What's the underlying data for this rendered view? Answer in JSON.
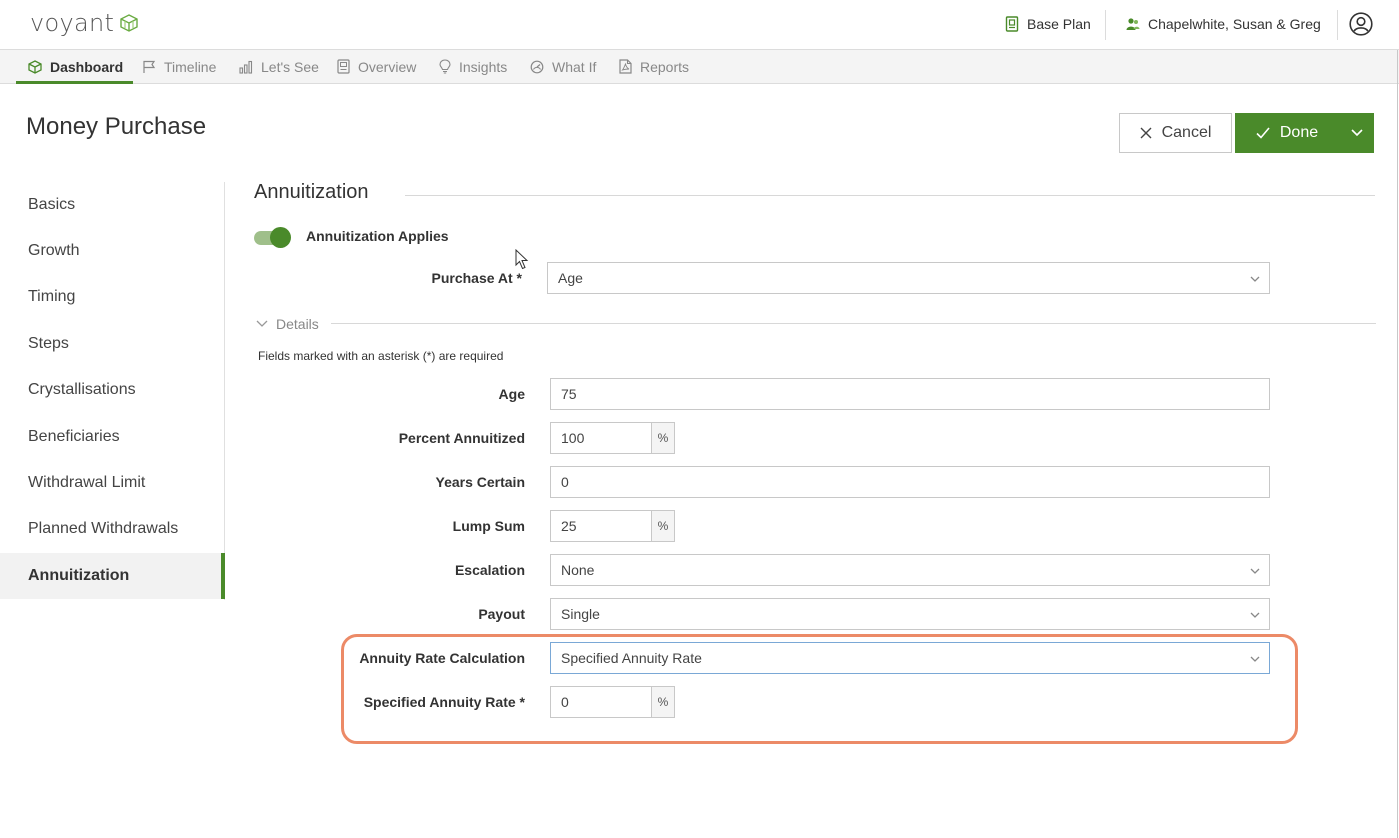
{
  "header": {
    "logo_text": "voyant",
    "plan_label": "Base Plan",
    "client_label": "Chapelwhite, Susan & Greg",
    "brand_color": "#4a8a2a"
  },
  "tabs": [
    {
      "label": "Dashboard",
      "icon": "dashboard-icon",
      "active": true
    },
    {
      "label": "Timeline",
      "icon": "flag-icon"
    },
    {
      "label": "Let's See",
      "icon": "bar-chart-icon"
    },
    {
      "label": "Overview",
      "icon": "document-icon"
    },
    {
      "label": "Insights",
      "icon": "lightbulb-icon"
    },
    {
      "label": "What If",
      "icon": "gauge-icon"
    },
    {
      "label": "Reports",
      "icon": "pdf-icon"
    }
  ],
  "page": {
    "title": "Money Purchase",
    "cancel_label": "Cancel",
    "done_label": "Done"
  },
  "sidebar": {
    "items": [
      {
        "label": "Basics"
      },
      {
        "label": "Growth"
      },
      {
        "label": "Timing"
      },
      {
        "label": "Steps"
      },
      {
        "label": "Crystallisations"
      },
      {
        "label": "Beneficiaries"
      },
      {
        "label": "Withdrawal Limit"
      },
      {
        "label": "Planned Withdrawals"
      },
      {
        "label": "Annuitization",
        "active": true
      }
    ]
  },
  "section": {
    "title": "Annuitization",
    "toggle_label": "Annuitization Applies",
    "toggle_on": true,
    "purchase_at_label": "Purchase At *",
    "purchase_at_value": "Age",
    "details_label": "Details",
    "required_note": "Fields marked with an asterisk (*) are required"
  },
  "form": {
    "age_label": "Age",
    "age_value": "75",
    "percent_annuitized_label": "Percent Annuitized",
    "percent_annuitized_value": "100",
    "years_certain_label": "Years Certain",
    "years_certain_value": "0",
    "lump_sum_label": "Lump Sum",
    "lump_sum_value": "25",
    "escalation_label": "Escalation",
    "escalation_value": "None",
    "payout_label": "Payout",
    "payout_value": "Single",
    "rate_calc_label": "Annuity Rate Calculation",
    "rate_calc_value": "Specified Annuity Rate",
    "specified_rate_label": "Specified Annuity Rate *",
    "specified_rate_value": "0",
    "percent_suffix": "%"
  },
  "highlight_color": "#ec8a67"
}
